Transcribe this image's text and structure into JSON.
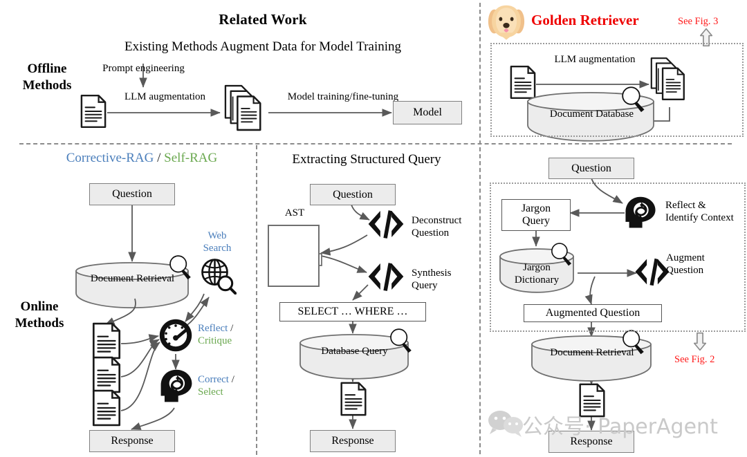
{
  "figure": {
    "title": "Related Work",
    "subtitle": "Existing Methods Augment Data for Model Training",
    "golden_title": "Golden Retriever",
    "dog_icon": "golden-retriever-dog-icon"
  },
  "row_labels": {
    "offline": "Offline\nMethods",
    "offline_line1": "Offline",
    "offline_line2": "Methods",
    "online_line1": "Online",
    "online_line2": "Methods"
  },
  "colors": {
    "accent_red": "#ee0000",
    "accent_blue": "#4a7ebb",
    "accent_green": "#6aa84f",
    "box_fill": "#ececec",
    "box_border": "#7f7f7f",
    "line": "#595959",
    "dog_body": "#f5c98a"
  },
  "offline_related": {
    "prompt_engineering": "Prompt engineering",
    "llm_augmentation": "LLM augmentation",
    "model_training": "Model training/fine-tuning",
    "model_box": "Model",
    "doc_icon": "document-icon",
    "doc_stack_icon": "document-stack-icon"
  },
  "offline_golden": {
    "llm_augmentation": "LLM augmentation",
    "document_database": "Document Database",
    "see_fig": "See Fig. 3",
    "up_arrow_icon": "arrow-up-icon",
    "doc_icon": "document-icon",
    "doc_stack_icon": "document-stack-icon",
    "magnifier_icon": "magnifier-icon",
    "database_icon": "database-cylinder-icon"
  },
  "online_left": {
    "heading_a": "Corrective-RAG",
    "heading_sep": " / ",
    "heading_b": "Self-RAG",
    "question": "Question",
    "document_retrieval": "Document Retrieval",
    "web_search_l1": "Web",
    "web_search_l2": "Search",
    "reflect": "Reflect",
    "critique": "Critique",
    "correct": "Correct",
    "select": "Select",
    "slash": " / ",
    "response": "Response",
    "globe_icon": "globe-search-icon",
    "gauge_icon": "gauge-reflect-icon",
    "head_icon": "head-refresh-icon",
    "magnifier_icon": "magnifier-icon",
    "doc_icon": "document-icon"
  },
  "online_mid": {
    "heading": "Extracting Structured Query",
    "question": "Question",
    "ast": "AST",
    "deconstruct_l1": "Deconstruct",
    "deconstruct_l2": "Question",
    "synthesis_l1": "Synthesis",
    "synthesis_l2": "Query",
    "select_where": "SELECT … WHERE …",
    "database_query": "Database Query",
    "response": "Response",
    "code_icon": "code-brackets-icon",
    "ast_tree_icon": "ast-tree-icon",
    "magnifier_icon": "magnifier-icon",
    "doc_icon": "document-icon"
  },
  "online_right": {
    "question": "Question",
    "jargon_query_l1": "Jargon",
    "jargon_query_l2": "Query",
    "reflect_l1": "Reflect &",
    "reflect_l2": "Identify Context",
    "jargon_dict_l1": "Jargon",
    "jargon_dict_l2": "Dictionary",
    "augment_l1": "Augment",
    "augment_l2": "Question",
    "augmented_question": "Augmented Question",
    "document_retrieval": "Document Retrieval",
    "see_fig": "See Fig. 2",
    "response": "Response",
    "down_arrow_icon": "arrow-down-icon",
    "head_icon": "head-refresh-icon",
    "code_icon": "code-brackets-icon",
    "magnifier_icon": "magnifier-icon",
    "doc_icon": "document-icon"
  },
  "watermark": {
    "text": "公众号· PaperAgent",
    "icon": "wechat-icon"
  }
}
